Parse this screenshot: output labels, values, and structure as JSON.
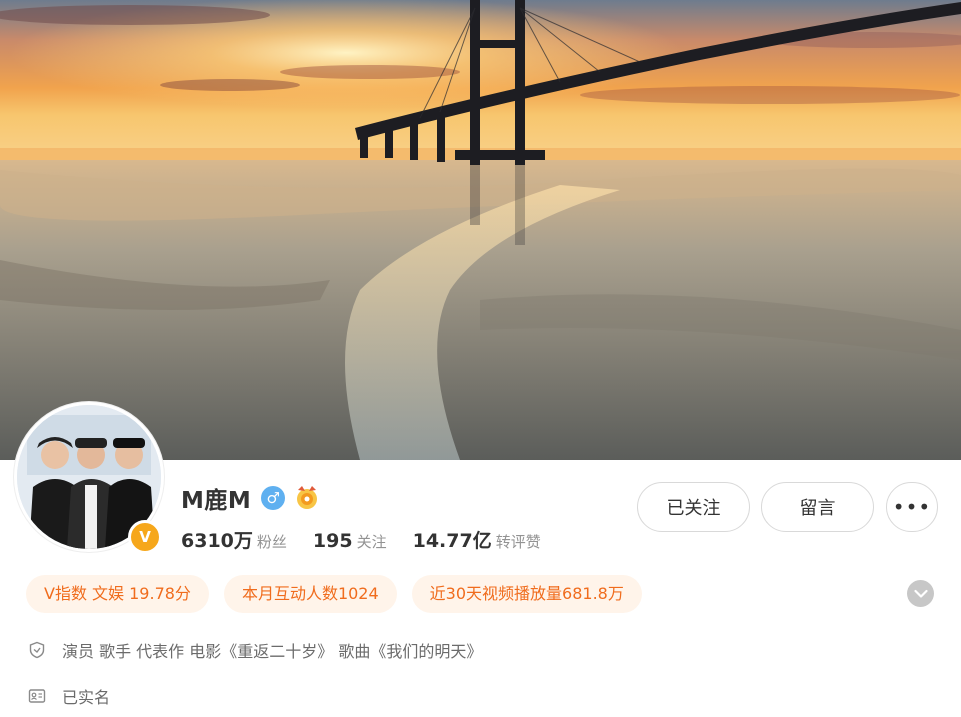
{
  "profile": {
    "username": "M鹿M",
    "gender_icon": "male-icon",
    "badge_icon": "medal-icon",
    "verified_badge": "V",
    "accent_color": "#f06c1d"
  },
  "stats": [
    {
      "value": "6310万",
      "label": "粉丝"
    },
    {
      "value": "195",
      "label": "关注"
    },
    {
      "value": "14.77亿",
      "label": "转评赞"
    }
  ],
  "actions": {
    "follow_label": "已关注",
    "message_label": "留言",
    "more_label": "•••"
  },
  "tags": [
    "V指数 文娱 19.78分",
    "本月互动人数1024",
    "近30天视频播放量681.8万"
  ],
  "bio": {
    "description": "演员 歌手 代表作 电影《重返二十岁》 歌曲《我们的明天》",
    "verification": "已实名"
  }
}
